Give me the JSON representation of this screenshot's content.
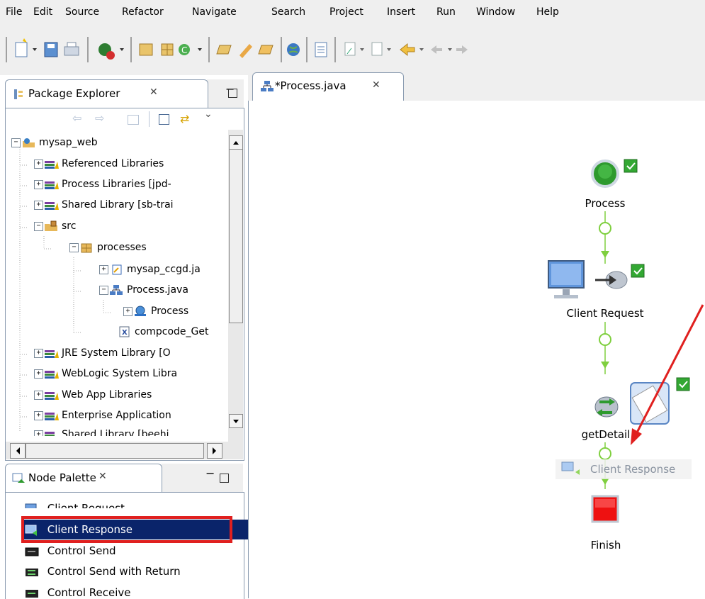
{
  "menu": [
    "File",
    "Edit",
    "Source",
    "Refactor",
    "Navigate",
    "Search",
    "Project",
    "Insert",
    "Run",
    "Window",
    "Help"
  ],
  "package_explorer": {
    "title": "Package Explorer",
    "tree": [
      {
        "label": "mysap_web",
        "icon": "project-icon",
        "expander": "−"
      },
      {
        "label": "Referenced Libraries",
        "icon": "library-icon",
        "expander": "+"
      },
      {
        "label": "Process Libraries [jpd-",
        "icon": "library-icon",
        "expander": "+"
      },
      {
        "label": "Shared Library [sb-trai",
        "icon": "library-icon",
        "expander": "+"
      },
      {
        "label": "src",
        "icon": "source-folder-icon",
        "expander": "−"
      },
      {
        "label": "processes",
        "icon": "package-icon",
        "expander": "−"
      },
      {
        "label": "mysap_ccgd.ja",
        "icon": "java-control-icon",
        "expander": "+"
      },
      {
        "label": "Process.java",
        "icon": "process-file-icon",
        "expander": "−"
      },
      {
        "label": "Process",
        "icon": "process-class-icon",
        "expander": "+"
      },
      {
        "label": "compcode_Get",
        "icon": "xml-file-icon",
        "expander": ""
      },
      {
        "label": "JRE System Library [O",
        "icon": "library-icon",
        "expander": "+"
      },
      {
        "label": "WebLogic System Libra",
        "icon": "library-icon",
        "expander": "+"
      },
      {
        "label": "Web App Libraries",
        "icon": "library-icon",
        "expander": "+"
      },
      {
        "label": "Enterprise Application",
        "icon": "library-icon",
        "expander": "+"
      },
      {
        "label": "Shared Library [beehi",
        "icon": "library-icon",
        "expander": "+"
      }
    ]
  },
  "node_palette": {
    "title": "Node Palette",
    "items": [
      "Client Request",
      "Client Response",
      "Control Send",
      "Control Send with Return",
      "Control Receive"
    ],
    "selected": "Client Response"
  },
  "editor": {
    "tab_title": "*Process.java",
    "nodes": {
      "start": "Process",
      "client_request": "Client Request",
      "get_detail": "getDetail",
      "drag_preview": "Client Response",
      "finish": "Finish"
    }
  },
  "colors": {
    "selection": "#0a246a",
    "highlight_box": "#e0201f",
    "annotation_arrow": "#e0201f",
    "connector": "#7fcf3f"
  }
}
